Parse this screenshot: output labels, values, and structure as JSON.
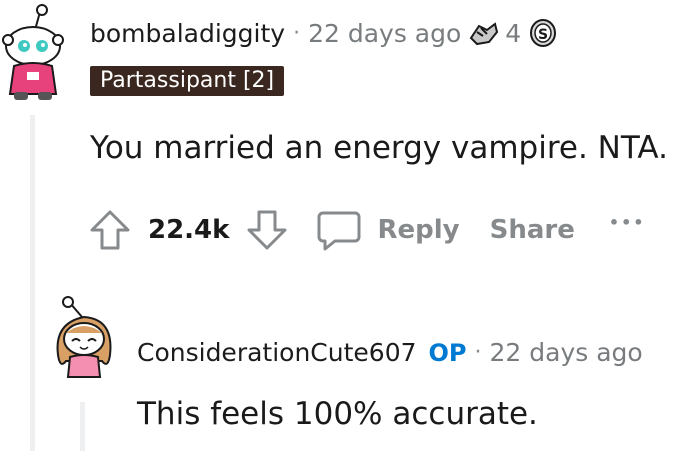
{
  "comment": {
    "username": "bombaladiggity",
    "separator": "·",
    "timestamp": "22 days ago",
    "award_count": "4",
    "flair": "Partassipant [2]",
    "body": "You married an energy vampire. NTA.",
    "score": "22.4k",
    "reply_label": "Reply",
    "share_label": "Share",
    "more_label": "•••"
  },
  "reply": {
    "username": "ConsiderationCute607",
    "op_badge": "OP",
    "separator": "·",
    "timestamp": "22 days ago",
    "body": "This feels 100% accurate."
  },
  "colors": {
    "flair_bg": "#3a2820",
    "op_blue": "#0079d3",
    "muted": "#878a8c",
    "thread_line": "#edeff1"
  }
}
